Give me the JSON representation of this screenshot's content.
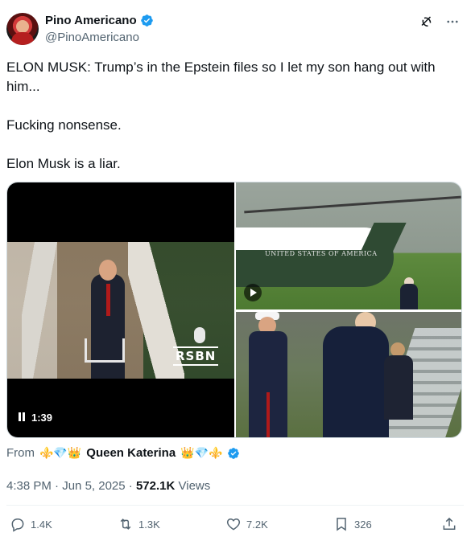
{
  "author": {
    "display_name": "Pino Americano",
    "handle": "@PinoAmericano",
    "verified": true,
    "verified_color": "#1d9bf0"
  },
  "top_actions": {
    "icons": [
      "grok-icon",
      "more-icon"
    ]
  },
  "tweet": {
    "paragraphs": [
      "ELON MUSK: Trump’s in the Epstein files so I let my son hang out with him...",
      "Fucking nonsense.",
      "Elon Musk is a liar."
    ]
  },
  "media": {
    "video": {
      "watermark": "RSBN",
      "timestamp": "1:39"
    },
    "photo_top": {
      "caption_on_image": "UNITED STATES OF AMERICA"
    }
  },
  "community": {
    "from_label": "From",
    "deco_left": "⚜️💎👑",
    "name": "Queen Katerina",
    "deco_right": "👑💎⚜️"
  },
  "meta": {
    "time": "4:38 PM",
    "separator": "·",
    "date": "Jun 5, 2025",
    "views_count": "572.1K",
    "views_label": "Views"
  },
  "stats": {
    "replies": "1.4K",
    "reposts": "1.3K",
    "likes": "7.2K",
    "bookmarks": "326"
  },
  "colors": {
    "text_primary": "#0f1419",
    "text_secondary": "#536471",
    "accent": "#1d9bf0",
    "divider": "#eff3f4"
  }
}
